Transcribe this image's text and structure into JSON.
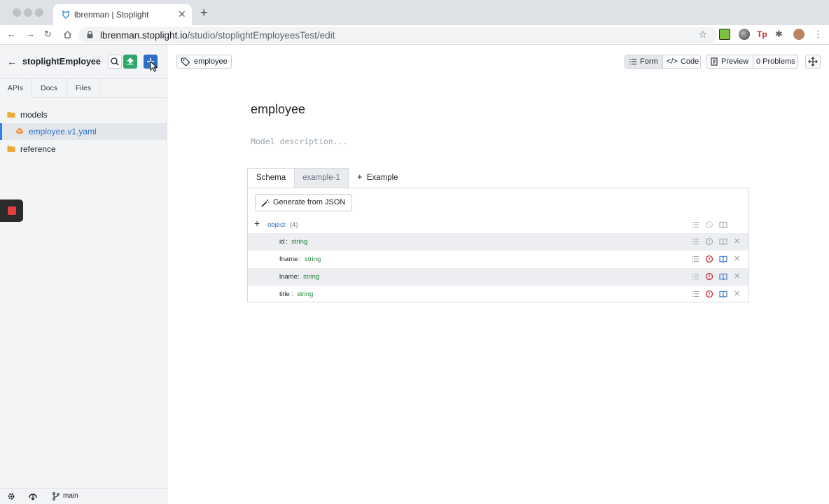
{
  "browser": {
    "tab_title": "lbrenman | Stoplight",
    "url_host": "lbrenman.stoplight.io",
    "url_path": "/studio/stoplightEmployeesTest/edit"
  },
  "sidebar": {
    "project_name": "stoplightEmployee",
    "tabs": [
      {
        "label": "APIs"
      },
      {
        "label": "Docs"
      },
      {
        "label": "Files"
      }
    ],
    "tree": [
      {
        "label": "models"
      },
      {
        "label": "employee.v1.yaml"
      },
      {
        "label": "reference"
      }
    ],
    "branch": "main"
  },
  "toolbar": {
    "breadcrumb_tag": "employee",
    "form_label": "Form",
    "code_label": "Code",
    "preview_label": "Preview",
    "problems_label": "0 Problems"
  },
  "model": {
    "title": "employee",
    "description_placeholder": "Model description...",
    "tabs": [
      {
        "label": "Schema"
      },
      {
        "label": "example-1"
      },
      {
        "label": "Example"
      }
    ],
    "generate_label": "Generate from JSON",
    "root": {
      "type": "object",
      "count": "{4}"
    },
    "properties": [
      {
        "name": "id",
        "type": "string"
      },
      {
        "name": "fname",
        "type": "string"
      },
      {
        "name": "lname",
        "type": "string"
      },
      {
        "name": "title",
        "type": "string"
      }
    ]
  },
  "colors": {
    "accent": "#2f80ed",
    "type_green": "#22863a",
    "required_red": "#d1242f",
    "publish_green": "#2fa66a"
  }
}
